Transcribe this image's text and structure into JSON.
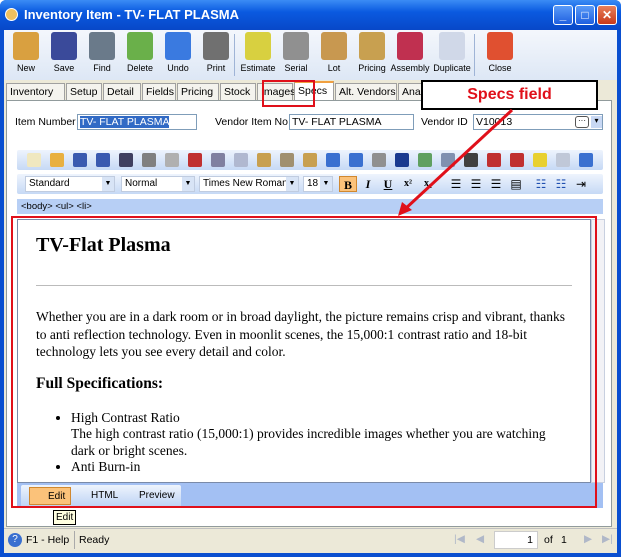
{
  "window": {
    "title": "Inventory Item - TV- FLAT PLASMA",
    "controls": [
      "minimize",
      "maximize",
      "close"
    ]
  },
  "toolbar": [
    {
      "label": "New",
      "icon": "new-item-icon",
      "color": "#d9a040"
    },
    {
      "label": "Save",
      "icon": "floppy-icon",
      "color": "#3a4a9a"
    },
    {
      "label": "Find",
      "icon": "binoculars-icon",
      "color": "#6a7a8a"
    },
    {
      "label": "Delete",
      "icon": "recycle-bin-icon",
      "color": "#6ab04a"
    },
    {
      "label": "Undo",
      "icon": "undo-arrow-icon",
      "color": "#3a7ae0"
    },
    {
      "label": "Print",
      "icon": "printer-icon",
      "color": "#707070"
    },
    {
      "label": "Estimate",
      "icon": "estimate-icon",
      "color": "#d8d040"
    },
    {
      "label": "Serial",
      "icon": "barcode-icon",
      "color": "#909090"
    },
    {
      "label": "Lot",
      "icon": "lot-box-icon",
      "color": "#c89850"
    },
    {
      "label": "Pricing",
      "icon": "pricing-icon",
      "color": "#c8a050"
    },
    {
      "label": "Assembly",
      "icon": "assembly-icon",
      "color": "#c03050"
    },
    {
      "label": "Duplicate",
      "icon": "duplicate-icon",
      "color": "#d0d8e8"
    },
    {
      "label": "Close",
      "icon": "close-doc-icon",
      "color": "#e05030"
    }
  ],
  "tabs": [
    "Inventory",
    "Setup",
    "Detail",
    "Fields",
    "Pricing",
    "Stock",
    "Images",
    "Specs",
    "Alt. Vendors",
    "Analysis"
  ],
  "active_tab": "Specs",
  "form": {
    "item_number_label": "Item Number",
    "item_number": "TV- FLAT PLASMA",
    "vendor_item_label": "Vendor Item No",
    "vendor_item": "TV- FLAT PLASMA",
    "vendor_id_label": "Vendor ID",
    "vendor_id": "V10013"
  },
  "format": {
    "style": "Standard",
    "paragraph": "Normal",
    "font": "Times New Roman",
    "size": "18",
    "bold": "B",
    "italic": "I",
    "underline": "U",
    "superscript": "x²",
    "subscript": "x₂"
  },
  "path": "<body> <ul> <li>",
  "document": {
    "heading": "TV-Flat Plasma",
    "paragraph": "Whether you are in a dark room or in broad daylight, the picture remains crisp and vibrant, thanks to anti reflection technology. Even in moonlit scenes, the 15,000:1 contrast ratio and 18-bit technology lets you see every detail and color.",
    "subheading": "Full Specifications:",
    "items": [
      {
        "title": "High Contrast Ratio",
        "text": "The high contrast ratio (15,000:1) provides incredible images whether you are watching dark or bright scenes."
      },
      {
        "title": "Anti Burn-in",
        "text": ""
      }
    ]
  },
  "modes": [
    "Edit",
    "HTML",
    "Preview"
  ],
  "active_mode": "Edit",
  "tooltip": "Edit",
  "status": {
    "help": "F1 - Help",
    "state": "Ready",
    "page": "1",
    "of_label": "of",
    "total": "1"
  },
  "annotation": {
    "callout": "Specs field",
    "color": "#e0101a"
  }
}
